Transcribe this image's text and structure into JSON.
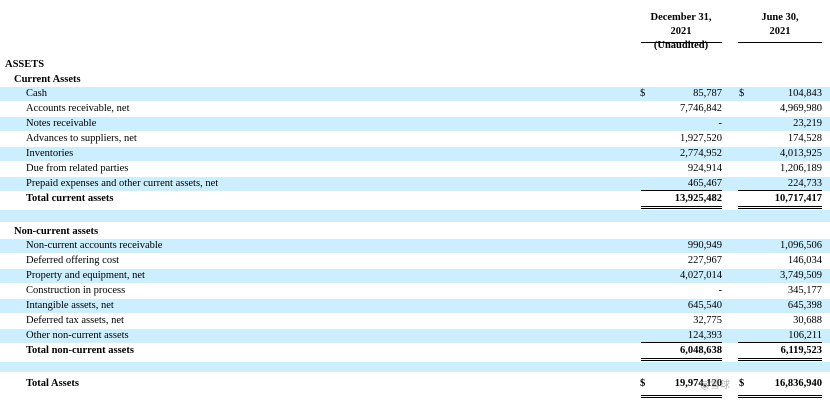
{
  "header": {
    "col1": [
      "December 31,",
      "2021",
      "(Unaudited)"
    ],
    "col2": [
      "June 30,",
      "2021"
    ]
  },
  "assets_title": "ASSETS",
  "current": {
    "title": "Current Assets",
    "rows": [
      {
        "label": "Cash",
        "cur": "$",
        "v1": "85,787",
        "cur2": "$",
        "v2": "104,843"
      },
      {
        "label": "Accounts receivable, net",
        "v1": "7,746,842",
        "v2": "4,969,980"
      },
      {
        "label": "Notes receivable",
        "v1": "-",
        "v2": "23,219"
      },
      {
        "label": "Advances to suppliers, net",
        "v1": "1,927,520",
        "v2": "174,528"
      },
      {
        "label": "Inventories",
        "v1": "2,774,952",
        "v2": "4,013,925"
      },
      {
        "label": "Due from related parties",
        "v1": "924,914",
        "v2": "1,206,189"
      },
      {
        "label": "Prepaid expenses and other current assets, net",
        "v1": "465,467",
        "v2": "224,733"
      }
    ],
    "total": {
      "label": "Total current assets",
      "v1": "13,925,482",
      "v2": "10,717,417"
    }
  },
  "noncurrent": {
    "title": "Non-current assets",
    "rows": [
      {
        "label": "Non-current accounts receivable",
        "v1": "990,949",
        "v2": "1,096,506"
      },
      {
        "label": "Deferred offering cost",
        "v1": "227,967",
        "v2": "146,034"
      },
      {
        "label": "Property and equipment, net",
        "v1": "4,027,014",
        "v2": "3,749,509"
      },
      {
        "label": "Construction in process",
        "v1": "-",
        "v2": "345,177"
      },
      {
        "label": "Intangible assets, net",
        "v1": "645,540",
        "v2": "645,398"
      },
      {
        "label": "Deferred tax assets, net",
        "v1": "32,775",
        "v2": "30,688"
      },
      {
        "label": "Other non-current assets",
        "v1": "124,393",
        "v2": "106,211"
      }
    ],
    "total": {
      "label": "Total non-current assets",
      "v1": "6,048,638",
      "v2": "6,119,523"
    }
  },
  "total_assets": {
    "label": "Total Assets",
    "cur": "$",
    "v1": "19,974,120",
    "cur2": "$",
    "v2": "16,836,940"
  },
  "watermark": "@雪球"
}
